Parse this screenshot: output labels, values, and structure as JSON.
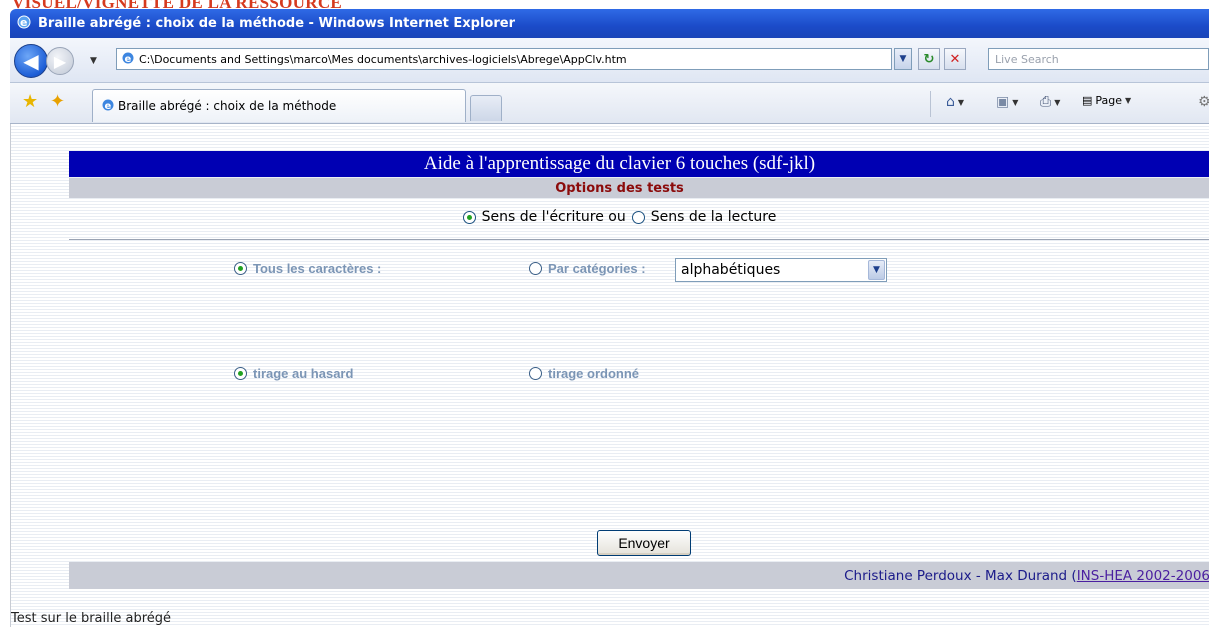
{
  "top_label": "VISUEL/VIGNETTE DE LA RESSOURCE",
  "window": {
    "title": "Braille abrégé : choix de la méthode - Windows Internet Explorer"
  },
  "navbar": {
    "address": "C:\\Documents and Settings\\marco\\Mes documents\\archives-logiciels\\Abrege\\AppClv.htm",
    "search_placeholder": "Live Search"
  },
  "tabbar": {
    "tab_title": "Braille abrégé : choix de la méthode",
    "page_label": "Page"
  },
  "page": {
    "header": "Aide à l'apprentissage du clavier 6 touches (sdf-jkl)",
    "subheader": "Options des tests",
    "sens_ecriture": "Sens de l'écriture ou",
    "sens_lecture": "Sens de la lecture",
    "tous_caracteres": "Tous les caractères :",
    "par_categories": "Par catégories :",
    "category_value": "alphabétiques",
    "tirage_hasard": "tirage au hasard",
    "tirage_ordonne": "tirage ordonné",
    "submit": "Envoyer",
    "footer_text": "Christiane Perdoux - Max Durand (",
    "footer_link": "INS-HEA 2002-2006",
    "status": "Test sur le braille abrégé"
  },
  "colors": {
    "header_bg": "#0000b3",
    "subheader_text": "#8b0b0b",
    "option_text": "#7b95b5",
    "radio_selected": "#21a121"
  }
}
